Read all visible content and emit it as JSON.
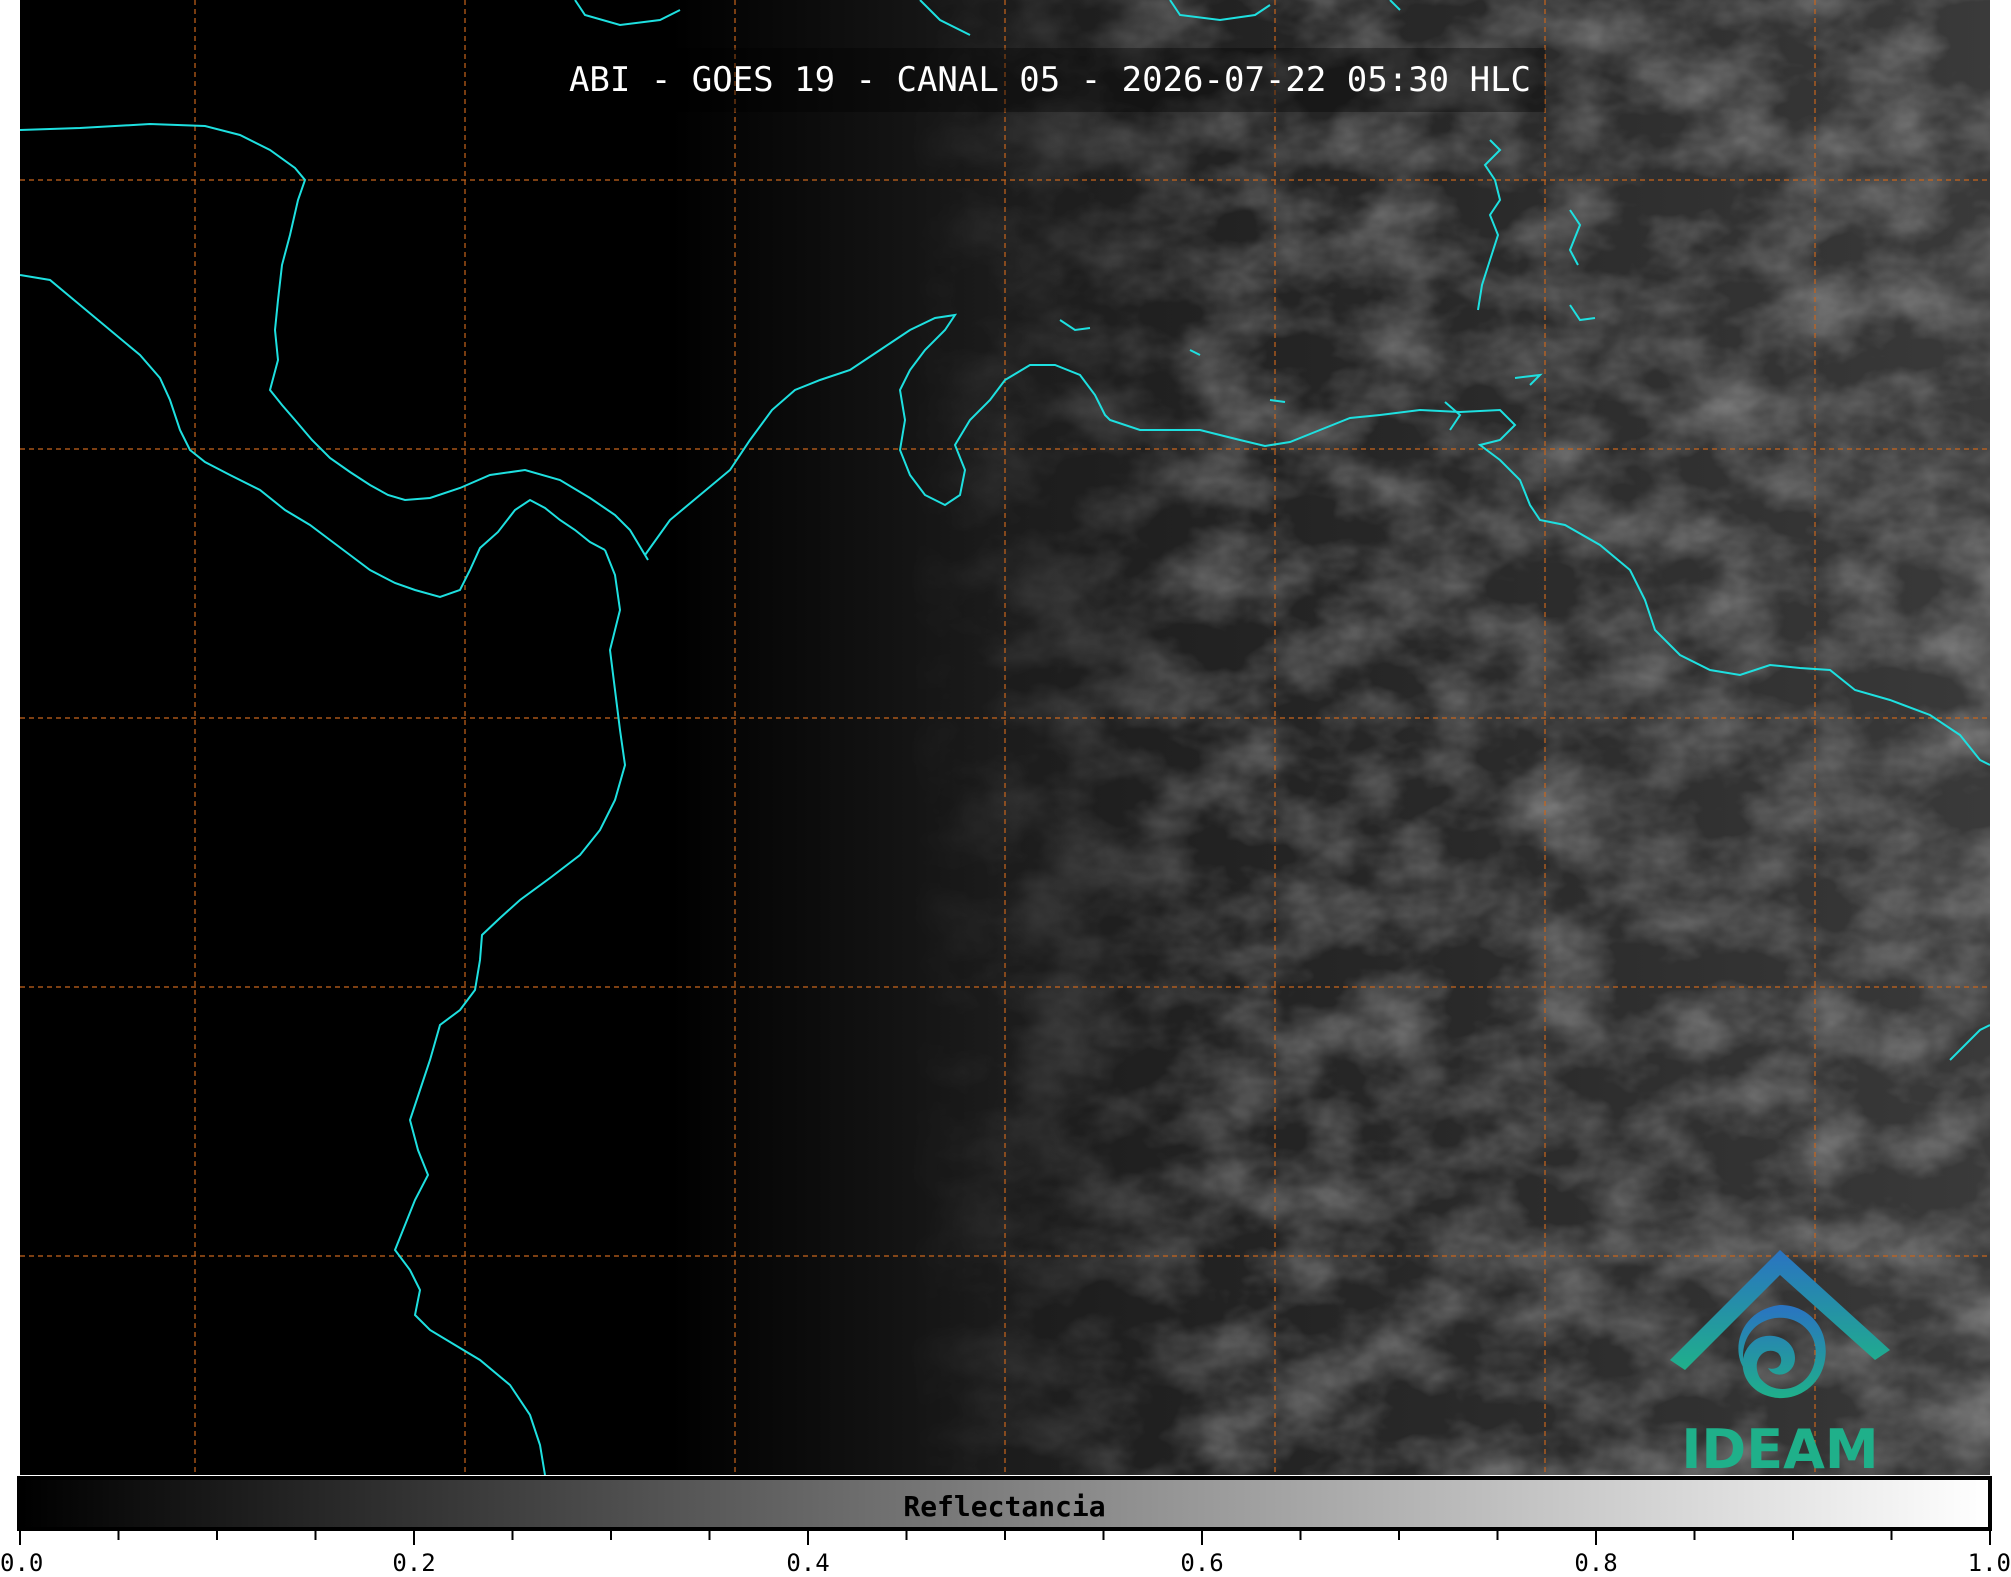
{
  "title": "ABI - GOES 19 - CANAL 05 - 2026-07-22 05:30 HLC",
  "colorbar": {
    "label": "Reflectancia",
    "min": 0.0,
    "max": 1.0,
    "major_ticks": [
      "0.0",
      "0.2",
      "0.4",
      "0.6",
      "0.8",
      "1.0"
    ],
    "minor_step": 0.05
  },
  "logo": {
    "text": "IDEAM"
  },
  "colors": {
    "coastline": "#1ee0e0",
    "graticule": "#c8651c",
    "logo_top": "#2a73c2",
    "logo_bottom": "#1fb08a"
  },
  "icons": [
    "ideam-logo-icon"
  ]
}
